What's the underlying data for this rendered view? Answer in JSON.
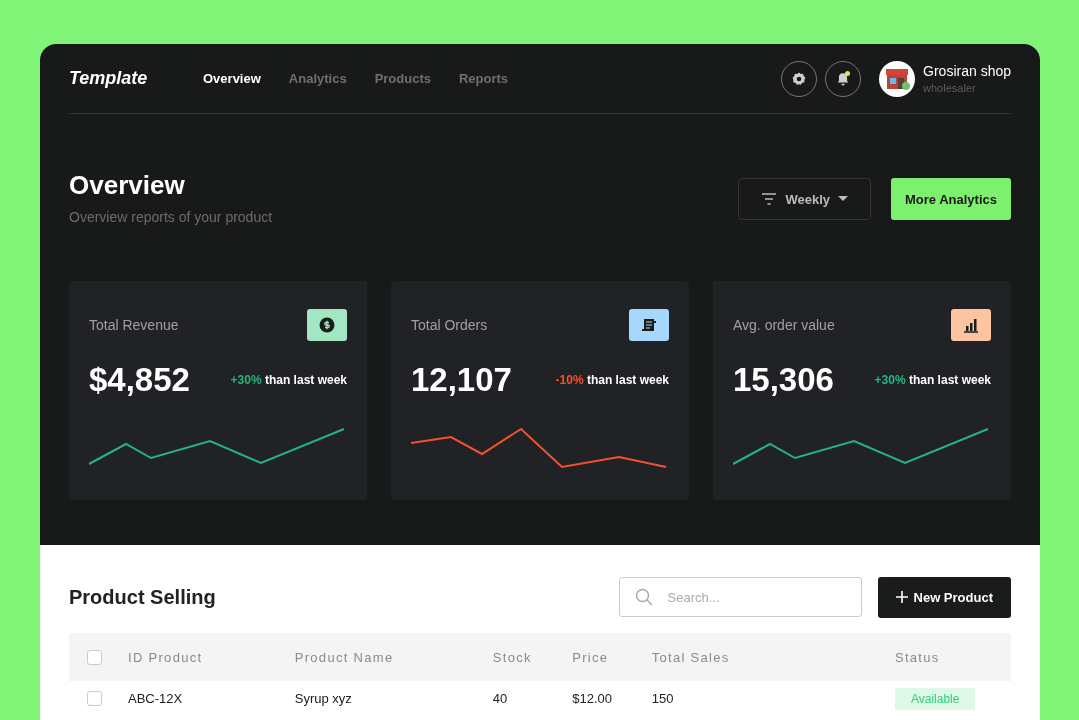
{
  "brand": "Template",
  "nav": [
    {
      "label": "Overview",
      "selected": true
    },
    {
      "label": "Analytics",
      "selected": false
    },
    {
      "label": "Products",
      "selected": false
    },
    {
      "label": "Reports",
      "selected": false
    }
  ],
  "notifications": {
    "unread": true
  },
  "user": {
    "name": "Grosiran shop",
    "role": "wholesaler"
  },
  "header": {
    "title": "Overview",
    "subtitle": "Overview reports of your product",
    "period": "Weekly",
    "action": "More Analytics"
  },
  "stats": [
    {
      "label": "Total Revenue",
      "value": "$4,852",
      "change": "+30%",
      "kind": "increase",
      "note": "than last week",
      "color": "#a3e6c2"
    },
    {
      "label": "Total Orders",
      "value": "12,107",
      "change": "-10%",
      "kind": "decrease",
      "note": "than last week",
      "color": "#a6d8fb"
    },
    {
      "label": "Avg. order value",
      "value": "15,306",
      "change": "+30%",
      "kind": "increase",
      "note": "than last week",
      "color": "#fdc4a1"
    }
  ],
  "products": {
    "title": "Product Selling",
    "search": {
      "placeholder": "Search..."
    },
    "new_button": "New Product",
    "header_checked": false,
    "columns": [
      "ID Product",
      "Product Name",
      "Stock",
      "Price",
      "Total Sales",
      "Status"
    ],
    "rows": [
      {
        "checked": false,
        "cells": [
          "ABC-12X",
          "Syrup xyz",
          "40",
          "$12.00",
          "150"
        ],
        "status": "Available"
      }
    ]
  }
}
